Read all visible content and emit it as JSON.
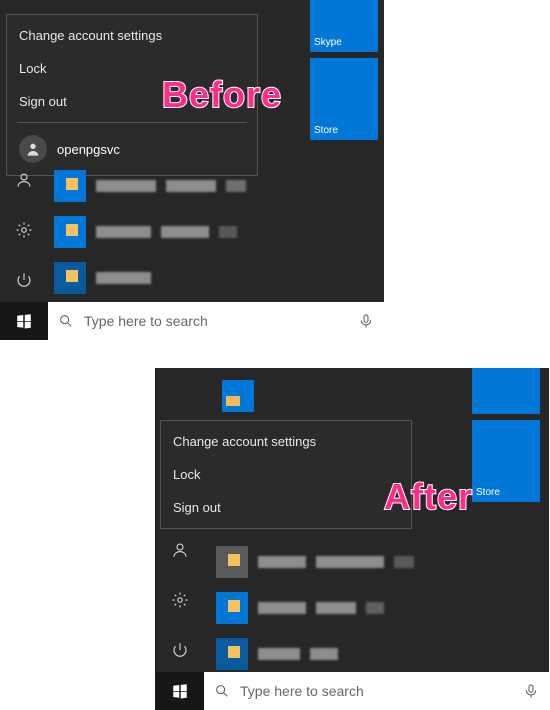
{
  "labels": {
    "before": "Before",
    "after": "After"
  },
  "tiles": {
    "skype": "Skype",
    "store": "Store"
  },
  "menu": {
    "change": "Change account settings",
    "lock": "Lock",
    "signout": "Sign out",
    "user": "openpgsvc"
  },
  "taskbar": {
    "search_placeholder": "Type here to search"
  }
}
